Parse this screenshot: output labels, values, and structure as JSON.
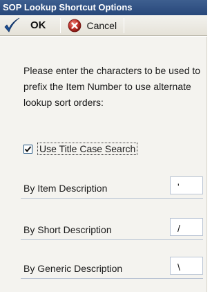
{
  "window": {
    "title": "SOP Lookup Shortcut Options"
  },
  "toolbar": {
    "ok_label": "OK",
    "cancel_label": "Cancel",
    "ok_icon": "checkmark-icon",
    "cancel_icon": "cancel-circle-icon"
  },
  "instructions": "Please enter the characters to be used to prefix the Item Number to use alternate lookup sort orders:",
  "option": {
    "label": "Use Title Case Search",
    "checked": true
  },
  "fields": [
    {
      "label": "By Item Description",
      "value": "'"
    },
    {
      "label": "By Short Description",
      "value": "/"
    },
    {
      "label": "By Generic Description",
      "value": "\\"
    }
  ],
  "colors": {
    "titlebar": "#27477a",
    "accent_check": "#1c5180",
    "cancel_red": "#c0302a"
  }
}
